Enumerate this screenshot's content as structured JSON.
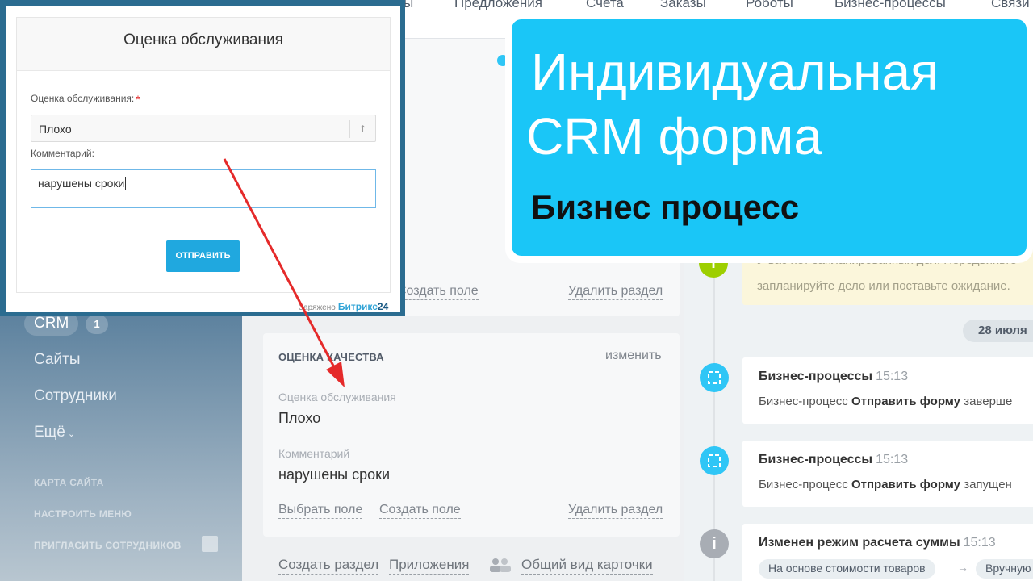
{
  "topnav": {
    "items": [
      "ы",
      "Предложения",
      "Счета",
      "Заказы",
      "Роботы",
      "Бизнес-процессы",
      "Связи"
    ]
  },
  "sidebar": {
    "crm": "CRM",
    "crm_count": "1",
    "sites": "Сайты",
    "employees": "Сотрудники",
    "more": "Ещё",
    "sitemap": "КАРТА САЙТА",
    "setup_menu": "НАСТРОИТЬ МЕНЮ",
    "invite": "ПРИГЛАСИТЬ СОТРУДНИКОВ"
  },
  "card_top": {
    "create_field": "Создать поле",
    "delete_section": "Удалить раздел"
  },
  "card_quality": {
    "title": "ОЦЕНКА КАЧЕСТВА",
    "edit": "изменить",
    "field1_label": "Оценка обслуживания",
    "field1_value": "Плохо",
    "field2_label": "Комментарий",
    "field2_value": "нарушены сроки",
    "select_field": "Выбрать поле",
    "create_field": "Создать поле",
    "delete_section": "Удалить раздел"
  },
  "bottom_links": {
    "create_section": "Создать раздел",
    "apps": "Приложения",
    "general_view": "Общий вид карточки"
  },
  "timeline": {
    "note_line1": "У вас нет запланированных дел. Передвиньте",
    "note_line2": "запланируйте дело или поставьте ожидание.",
    "date": "28 июля",
    "entries": [
      {
        "title": "Бизнес-процессы",
        "time": "15:13",
        "prefix": "Бизнес-процесс",
        "bold": "Отправить форму",
        "suffix": "заверше"
      },
      {
        "title": "Бизнес-процессы",
        "time": "15:13",
        "prefix": "Бизнес-процесс",
        "bold": "Отправить форму",
        "suffix": "запущен"
      },
      {
        "title": "Изменен режим расчета суммы",
        "time": "15:13",
        "chip1": "На основе стоимости товаров",
        "chip2": "Вручную"
      }
    ],
    "colors": {
      "bp": "#2fc6f6",
      "info": "#a8adb4",
      "note": "#9dcf00"
    }
  },
  "form": {
    "title": "Оценка обслуживания",
    "rating_label": "Оценка обслуживания:",
    "required_mark": "*",
    "rating_value": "Плохо",
    "comment_label": "Комментарий:",
    "comment_value": "нарушены сроки",
    "submit": "ОТПРАВИТЬ",
    "powered_prefix": "Заряжено",
    "powered_brand": "Битрикс",
    "powered_num": "24"
  },
  "banner": {
    "line1": "Индивидуальная",
    "line2": "CRM форма",
    "subtitle": "Бизнес процесс",
    "bg_color": "#1ac6f7"
  },
  "icons": {
    "note_dot": "info-icon",
    "bp_dot": "refresh-icon",
    "info_dot": "info-icon",
    "select_arrow": "sort-arrows-icon",
    "printer": "printer-icon",
    "people": "people-icon"
  }
}
